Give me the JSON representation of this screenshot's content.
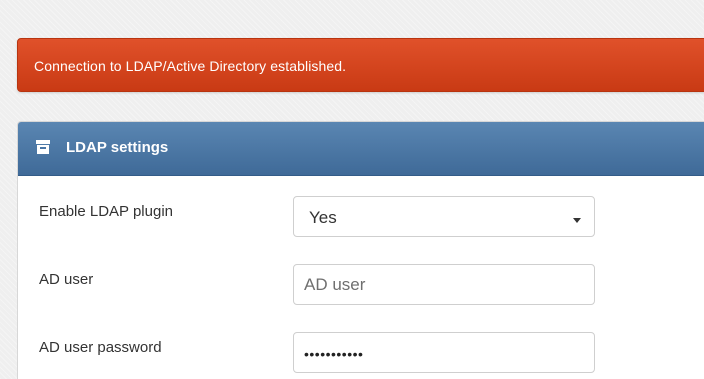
{
  "alert": {
    "message": "Connection to LDAP/Active Directory established.",
    "color": "#d2441c"
  },
  "panel": {
    "title": "LDAP settings",
    "icon": "archive-box-icon",
    "header_color": "#4a76a5"
  },
  "form": {
    "enable_plugin": {
      "label": "Enable LDAP plugin",
      "value": "Yes"
    },
    "ad_user": {
      "label": "AD user",
      "placeholder": "AD user",
      "value": ""
    },
    "ad_user_password": {
      "label": "AD user password",
      "masked_value": "•••••••••••"
    }
  }
}
